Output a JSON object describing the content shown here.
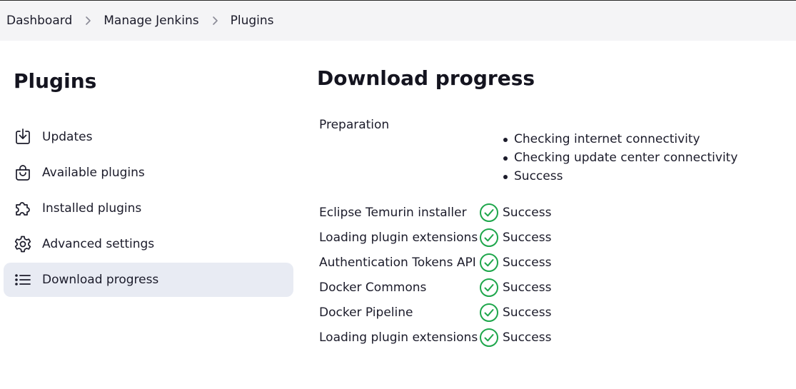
{
  "breadcrumb": {
    "items": [
      "Dashboard",
      "Manage Jenkins",
      "Plugins"
    ]
  },
  "sidebar": {
    "title": "Plugins",
    "items": [
      {
        "label": "Updates",
        "icon": "download-icon"
      },
      {
        "label": "Available plugins",
        "icon": "shopping-bag-icon"
      },
      {
        "label": "Installed plugins",
        "icon": "puzzle-piece-icon"
      },
      {
        "label": "Advanced settings",
        "icon": "gear-icon"
      },
      {
        "label": "Download progress",
        "icon": "list-icon",
        "active": true
      }
    ]
  },
  "main": {
    "title": "Download progress",
    "preparation": {
      "label": "Preparation",
      "steps": [
        "Checking internet connectivity",
        "Checking update center connectivity",
        "Success"
      ]
    },
    "rows": [
      {
        "name": "Eclipse Temurin installer",
        "status": "Success"
      },
      {
        "name": "Loading plugin extensions",
        "status": "Success"
      },
      {
        "name": "Authentication Tokens API",
        "status": "Success"
      },
      {
        "name": "Docker Commons",
        "status": "Success"
      },
      {
        "name": "Docker Pipeline",
        "status": "Success"
      },
      {
        "name": "Loading plugin extensions",
        "status": "Success"
      }
    ]
  },
  "colors": {
    "success": "#1ea64b",
    "active_nav_bg": "#e8ebf3",
    "breadcrumb_bg": "#f4f4f6"
  }
}
